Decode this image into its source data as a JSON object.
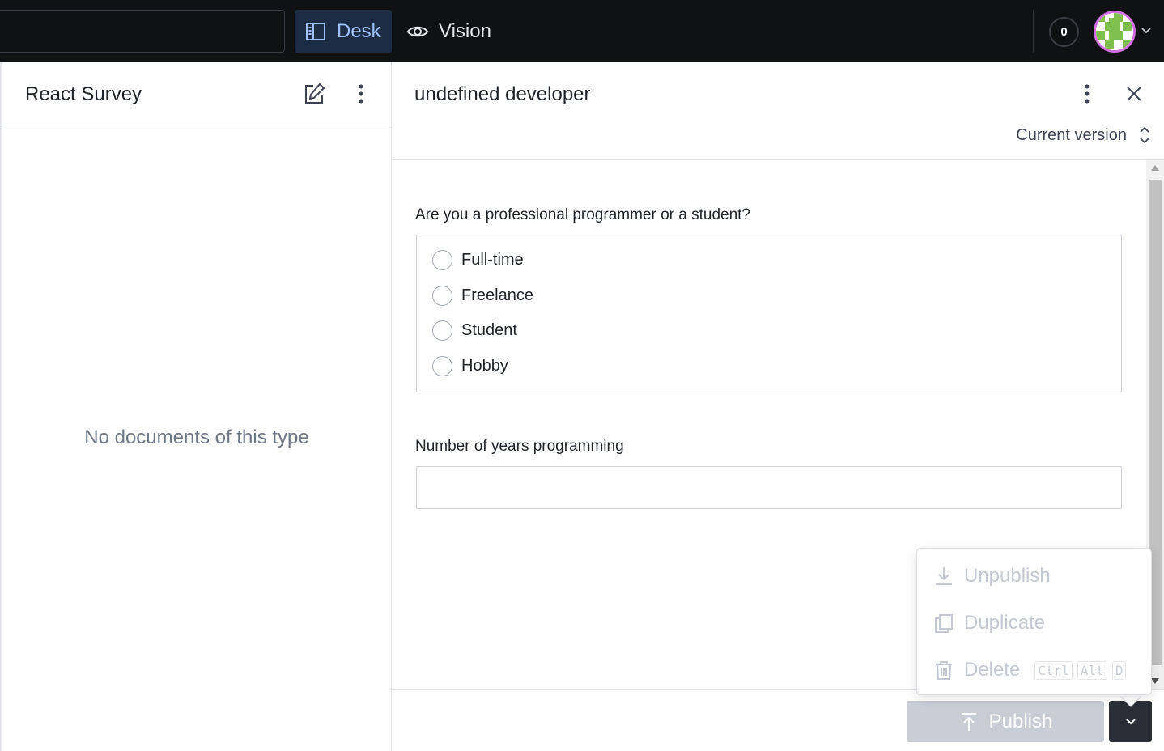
{
  "topbar": {
    "tools": [
      {
        "label": "Desk",
        "icon": "desk-icon",
        "active": true
      },
      {
        "label": "Vision",
        "icon": "eye-icon",
        "active": false
      }
    ],
    "notification_count": "0",
    "avatar_icon": "user-avatar"
  },
  "left_pane": {
    "title": "React Survey",
    "empty_message": "No documents of this type"
  },
  "document": {
    "title": "undefined developer",
    "version_label": "Current version",
    "fields": {
      "occupation": {
        "label": "Are you a professional programmer or a student?",
        "options": [
          "Full-time",
          "Freelance",
          "Student",
          "Hobby"
        ]
      },
      "years": {
        "label": "Number of years programming",
        "value": ""
      }
    }
  },
  "footer": {
    "publish_label": "Publish"
  },
  "menu": {
    "items": [
      {
        "label": "Unpublish",
        "icon": "unpublish-icon"
      },
      {
        "label": "Duplicate",
        "icon": "duplicate-icon"
      },
      {
        "label": "Delete",
        "icon": "trash-icon",
        "shortcut": [
          "Ctrl",
          "Alt",
          "D"
        ]
      }
    ]
  },
  "colors": {
    "topbar_bg": "#101112",
    "active_tool_bg": "#1d2c45",
    "active_tool_text": "#9ec2ff",
    "publish_disabled": "#c9cdd6",
    "avatar_ring": "#d26ee2"
  }
}
